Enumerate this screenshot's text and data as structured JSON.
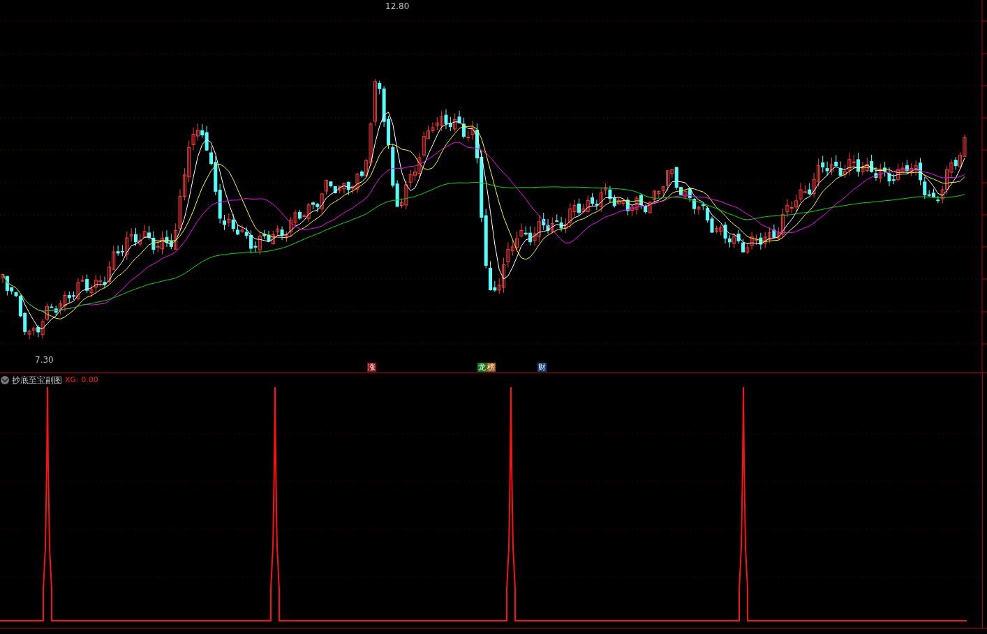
{
  "main_chart": {
    "high_label": "12.80",
    "low_label": "7.30"
  },
  "event_markers": [
    {
      "label": "涨",
      "color": "#8b0f0f"
    },
    {
      "label": "龙",
      "color": "#0f7a1a"
    },
    {
      "label": "榜",
      "color": "#9a5a10"
    },
    {
      "label": "财",
      "color": "#103e78"
    }
  ],
  "indicator": {
    "name": "抄底至宝副图",
    "reading": "XG: 0.00",
    "collapsed": false
  }
}
